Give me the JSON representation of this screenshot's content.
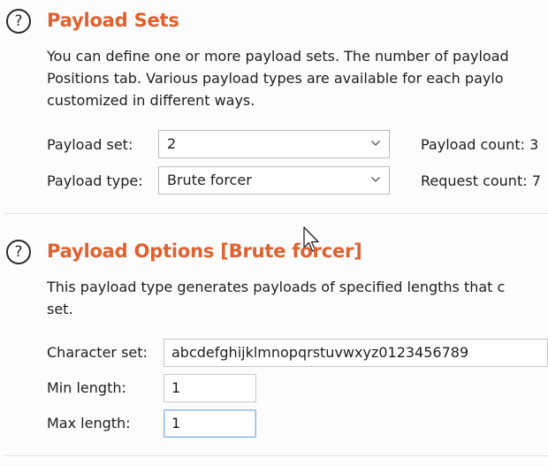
{
  "payload_sets": {
    "heading": "Payload Sets",
    "description_lines": [
      "You can define one or more payload sets. The number of payload",
      "Positions tab. Various payload types are available for each paylo",
      "customized in different ways."
    ],
    "payload_set_label": "Payload set:",
    "payload_set_value": "2",
    "payload_type_label": "Payload type:",
    "payload_type_value": "Brute forcer",
    "payload_count_label": "Payload count: 3",
    "request_count_label": "Request count: 7"
  },
  "payload_options": {
    "heading": "Payload Options [Brute forcer]",
    "description_lines": [
      "This payload type generates payloads of specified lengths that c",
      "set."
    ],
    "character_set_label": "Character set:",
    "character_set_value": "abcdefghijklmnopqrstuvwxyz0123456789",
    "min_length_label": "Min length:",
    "min_length_value": "1",
    "max_length_label": "Max length:",
    "max_length_value": "1"
  },
  "icons": {
    "help": "help-circle-icon",
    "chevron": "chevron-down-icon",
    "pointer": "mouse-pointer-icon"
  },
  "colors": {
    "heading": "#e0602e",
    "focus_border": "#8fb6e8"
  }
}
